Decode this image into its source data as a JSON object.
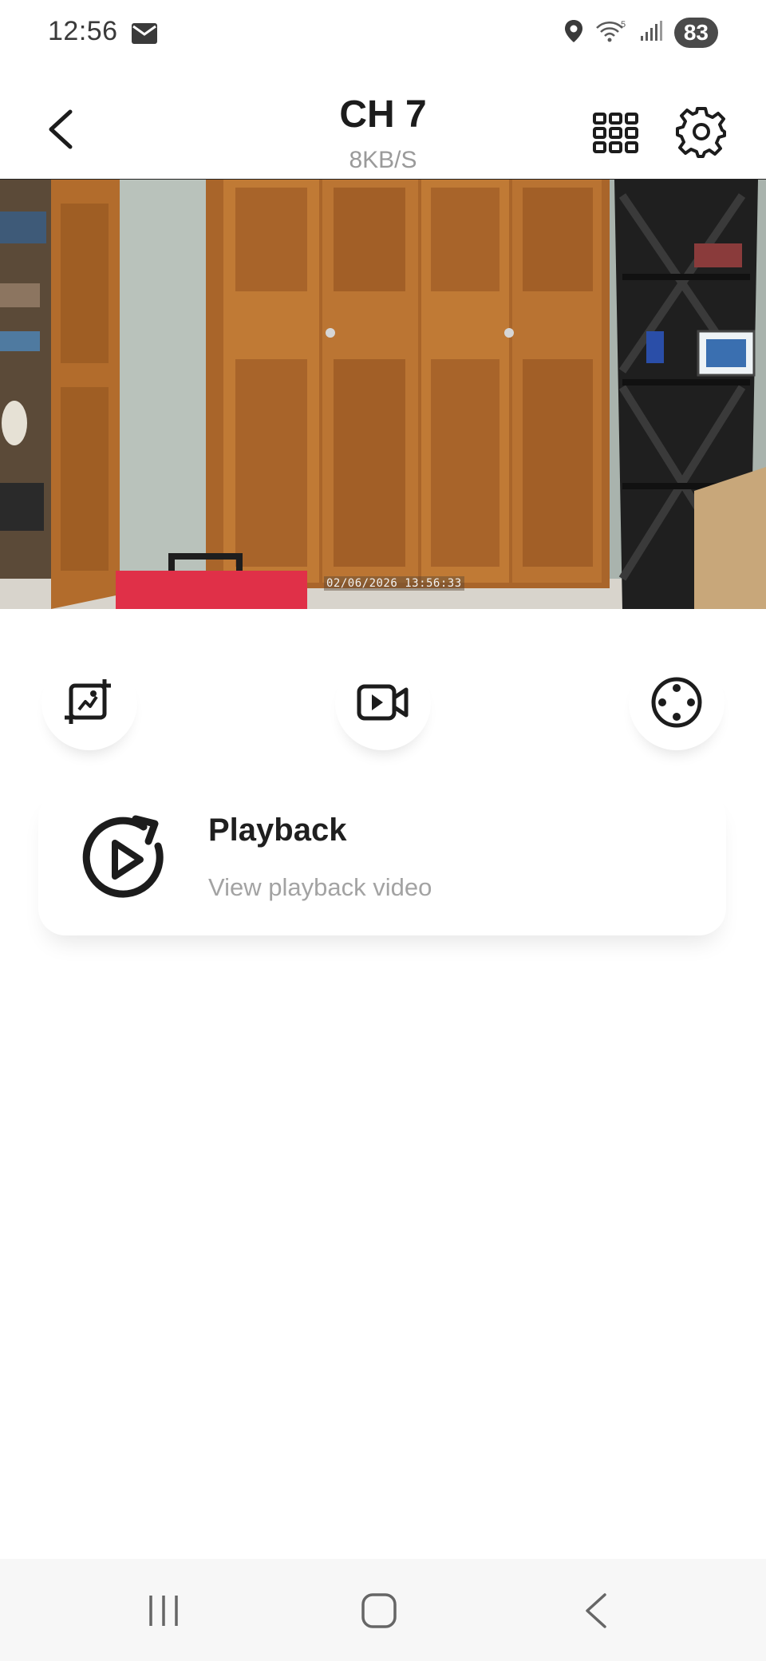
{
  "status_bar": {
    "time": "12:56",
    "battery": "83",
    "icons": [
      "mail-icon",
      "location-icon",
      "wifi-icon",
      "signal-icon"
    ]
  },
  "header": {
    "title": "CH 7",
    "bitrate": "8KB/S",
    "icons": [
      "back-icon",
      "grid-icon",
      "settings-icon"
    ]
  },
  "video": {
    "timestamp": "02/06/2026 13:56:33"
  },
  "actions": [
    {
      "name": "screenshot",
      "icon": "screenshot-icon"
    },
    {
      "name": "record",
      "icon": "record-video-icon"
    },
    {
      "name": "ptz",
      "icon": "ptz-control-icon"
    }
  ],
  "playback_card": {
    "title": "Playback",
    "subtitle": "View playback video",
    "icon": "playback-icon"
  },
  "nav": {
    "icons": [
      "recent-apps-icon",
      "home-icon",
      "back-icon"
    ]
  },
  "colors": {
    "accent": "#1c1c1c",
    "muted_text": "#a3a3a3",
    "background": "#ffffff"
  }
}
